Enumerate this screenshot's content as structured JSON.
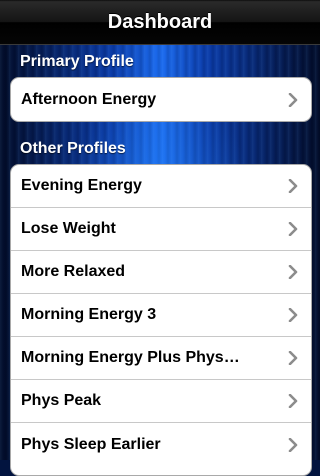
{
  "nav": {
    "title": "Dashboard"
  },
  "primary": {
    "header": "Primary Profile",
    "items": [
      {
        "label": "Afternoon Energy",
        "icon": "chevron-right-icon"
      }
    ]
  },
  "other": {
    "header": "Other Profiles",
    "items": [
      {
        "label": "Evening Energy",
        "icon": "chevron-right-icon"
      },
      {
        "label": "Lose Weight",
        "icon": "chevron-right-icon"
      },
      {
        "label": "More Relaxed",
        "icon": "chevron-right-icon"
      },
      {
        "label": "Morning Energy 3",
        "icon": "chevron-right-icon"
      },
      {
        "label": "Morning Energy Plus Phys…",
        "icon": "chevron-right-icon"
      },
      {
        "label": "Phys Peak",
        "icon": "chevron-right-icon"
      },
      {
        "label": "Phys Sleep Earlier",
        "icon": "chevron-right-icon"
      }
    ]
  },
  "colors": {
    "chevron": "#8c8c8c",
    "navbar": "#000000",
    "background": "#0a3aa8"
  }
}
